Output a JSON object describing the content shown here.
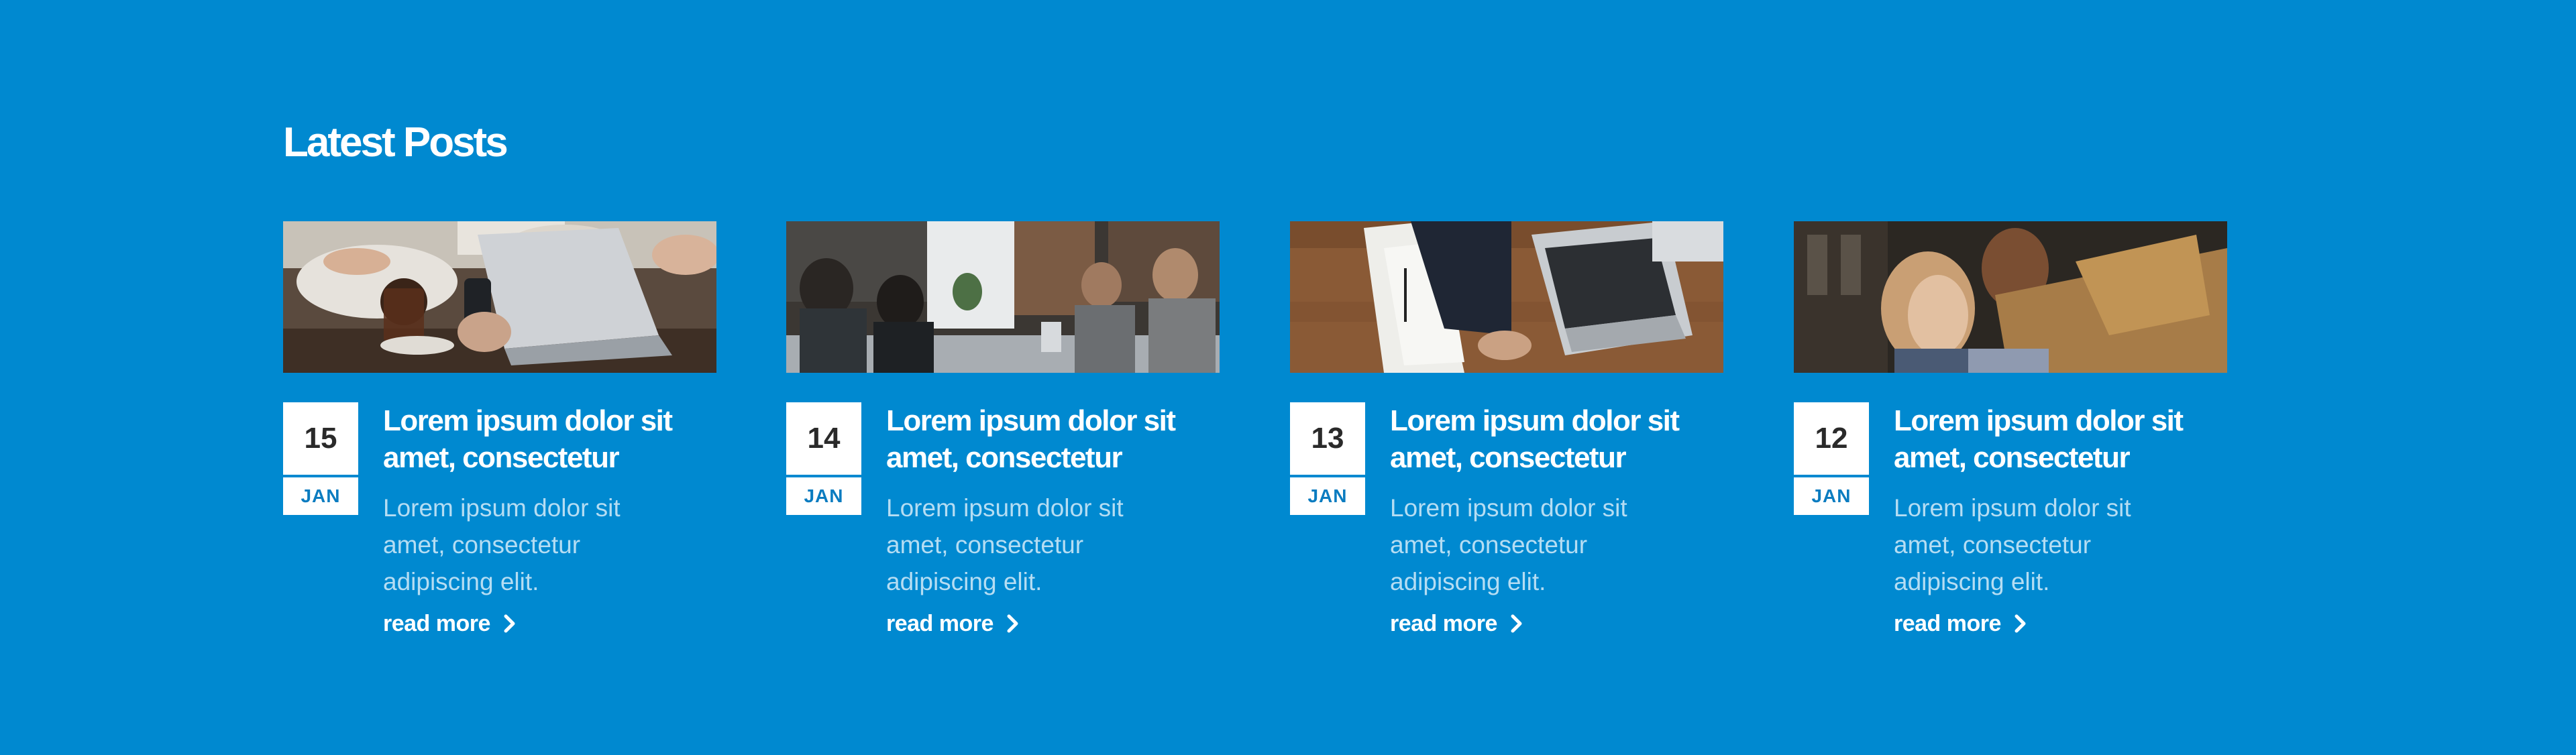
{
  "section": {
    "title": "Latest Posts"
  },
  "posts": [
    {
      "day": "15",
      "month": "JAN",
      "title": "Lorem ipsum dolor sit amet, consectetur",
      "excerpt": "Lorem ipsum dolor sit amet, consectetur adipiscing elit.",
      "link": "read more",
      "image_alt": "people-with-coffee-laptop-phone-photo"
    },
    {
      "day": "14",
      "month": "JAN",
      "title": "Lorem ipsum dolor sit amet, consectetur",
      "excerpt": "Lorem ipsum dolor sit amet, consectetur adipiscing elit.",
      "link": "read more",
      "image_alt": "team-meeting-photo"
    },
    {
      "day": "13",
      "month": "JAN",
      "title": "Lorem ipsum dolor sit amet, consectetur",
      "excerpt": "Lorem ipsum dolor sit amet, consectetur adipiscing elit.",
      "link": "read more",
      "image_alt": "laptop-and-documents-on-desk-photo"
    },
    {
      "day": "12",
      "month": "JAN",
      "title": "Lorem ipsum dolor sit amet, consectetur",
      "excerpt": "Lorem ipsum dolor sit amet, consectetur adipiscing elit.",
      "link": "read more",
      "image_alt": "two-people-working-photo"
    }
  ],
  "colors": {
    "background": "#0089d0",
    "date_box": "#ffffff",
    "month_text": "#0b7cc0",
    "excerpt_text": "#b5ddf3"
  },
  "icons": {
    "read_more": "chevron-right-icon"
  }
}
